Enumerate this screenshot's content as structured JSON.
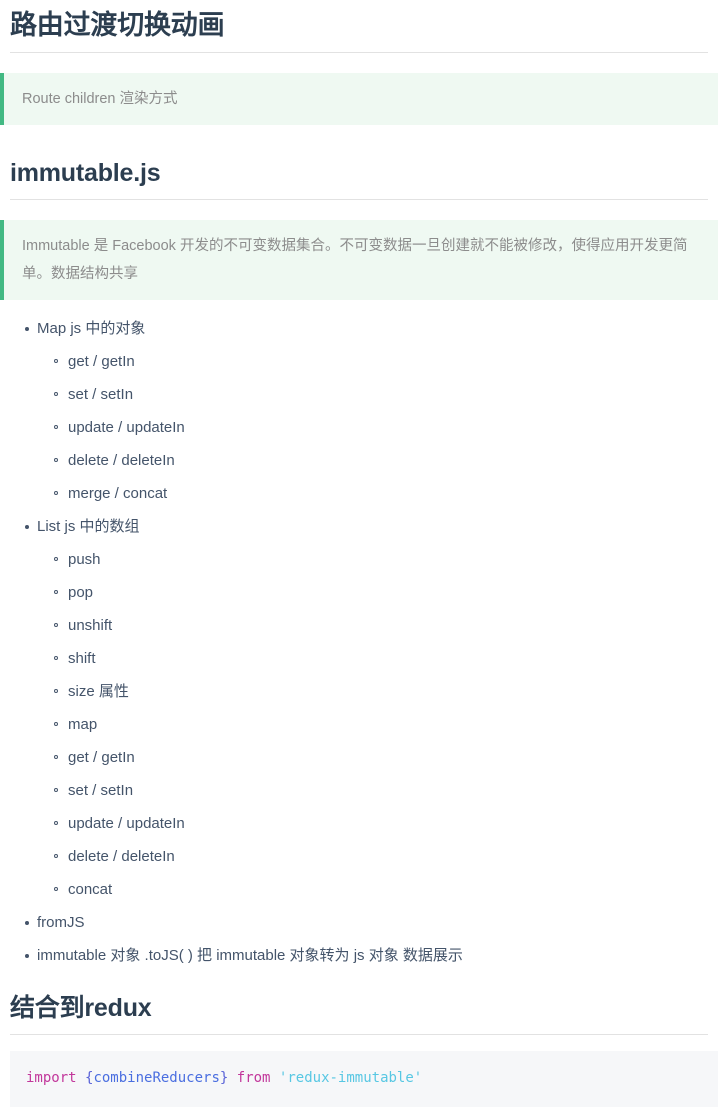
{
  "colors": {
    "heading": "#2c3e50",
    "body_text": "#44546a",
    "quote_accent": "#42b983",
    "quote_background": "#eff9f2",
    "quote_text": "#8c8c8c",
    "rule": "#e2e2e2",
    "code_background": "#f6f7f9",
    "code_keyword": "#c2379b",
    "code_punctuation": "#5a63d8",
    "code_identifier": "#4a6ee0",
    "code_string": "#57c7e3"
  },
  "sections": {
    "route_transition": {
      "title": "路由过渡切换动画",
      "note": "Route children 渲染方式"
    },
    "immutable": {
      "title": "immutable.js",
      "note": "Immutable 是 Facebook 开发的不可变数据集合。不可变数据一旦创建就不能被修改，使得应用开发更简单。数据结构共享",
      "list": [
        {
          "label": "Map  js 中的对象",
          "children": [
            "get / getIn",
            "set / setIn",
            "update / updateIn",
            "delete / deleteIn",
            "merge / concat"
          ]
        },
        {
          "label": "List   js 中的数组",
          "children": [
            "push",
            "pop",
            "unshift",
            "shift",
            "size 属性",
            "map",
            "get / getIn",
            "set / setIn",
            "update / updateIn",
            "delete / deleteIn",
            "concat"
          ]
        },
        {
          "label": "fromJS",
          "children": []
        },
        {
          "label": "immutable 对象 .toJS( )  把 immutable 对象转为 js 对象  数据展示",
          "children": []
        }
      ]
    },
    "redux": {
      "title": "结合到redux",
      "code": {
        "language": "javascript",
        "tokens": [
          {
            "text": "import",
            "type": "keyword"
          },
          {
            "text": " ",
            "type": "plain"
          },
          {
            "text": "{",
            "type": "punct"
          },
          {
            "text": "combineReducers",
            "type": "name"
          },
          {
            "text": "}",
            "type": "punct"
          },
          {
            "text": " ",
            "type": "plain"
          },
          {
            "text": "from",
            "type": "keyword"
          },
          {
            "text": " ",
            "type": "plain"
          },
          {
            "text": "'redux-immutable'",
            "type": "string"
          }
        ],
        "plain_text": "import {combineReducers} from 'redux-immutable'"
      }
    }
  }
}
